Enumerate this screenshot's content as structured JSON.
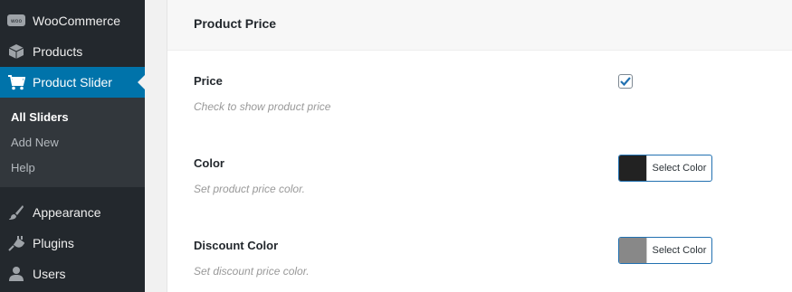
{
  "sidebar": {
    "items": [
      {
        "label": "WooCommerce",
        "icon": "woo-icon"
      },
      {
        "label": "Products",
        "icon": "products-icon"
      },
      {
        "label": "Product Slider",
        "icon": "cart-icon",
        "active": true
      },
      {
        "label": "Appearance",
        "icon": "paintbrush-icon"
      },
      {
        "label": "Plugins",
        "icon": "plugin-icon"
      },
      {
        "label": "Users",
        "icon": "users-icon"
      }
    ],
    "woo_badge": "woo",
    "submenu": [
      {
        "label": "All Sliders",
        "current": true
      },
      {
        "label": "Add New"
      },
      {
        "label": "Help"
      }
    ]
  },
  "panel": {
    "title": "Product Price",
    "fields": [
      {
        "label": "Price",
        "description": "Check to show product price",
        "type": "checkbox",
        "checked": true
      },
      {
        "label": "Color",
        "description": "Set product price color.",
        "type": "color",
        "color": "#222222",
        "button": "Select Color"
      },
      {
        "label": "Discount Color",
        "description": "Set discount price color.",
        "type": "color",
        "color": "#888888",
        "button": "Select Color"
      }
    ]
  },
  "colors": {
    "sidebar_bg": "#23282d",
    "submenu_bg": "#32373c",
    "accent": "#0073aa"
  }
}
